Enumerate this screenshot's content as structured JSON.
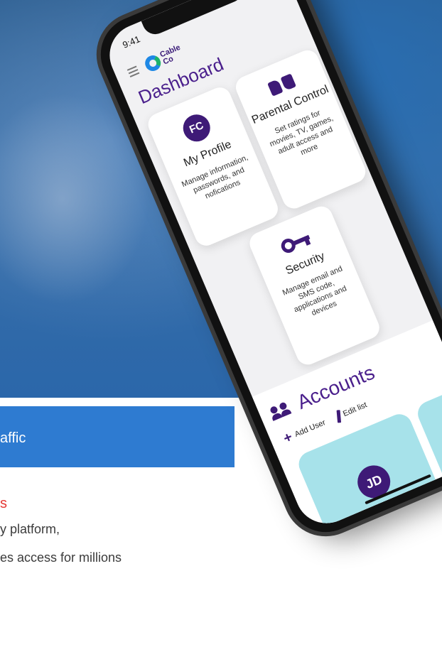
{
  "background": {
    "banner_text": "affic",
    "red_text": "s",
    "body_lines": [
      "y platform,",
      "es access for millions"
    ]
  },
  "status_bar": {
    "time": "9:41"
  },
  "app": {
    "logo_line1": "Cable",
    "logo_line2": "Co",
    "page_title": "Dashboard"
  },
  "cards": [
    {
      "title": "My Profile",
      "desc": "Manage information, passwords, and nofications",
      "icon": "avatar-fc",
      "icon_text": "FC"
    },
    {
      "title": "Parental Control",
      "desc": "Set ratings for movies, TV, games, adult access and more",
      "icon": "thumbs-icon"
    },
    {
      "title": "Security",
      "desc": "Manage email and SMS code, applications and devices",
      "icon": "key-icon"
    }
  ],
  "accounts": {
    "title": "Accounts",
    "add_user": "Add User",
    "edit_list": "Edit list",
    "users": [
      {
        "initials": "JD"
      }
    ]
  },
  "colors": {
    "primary_purple": "#3e1a77",
    "title_purple": "#4a1f8c",
    "banner_blue": "#2e7bd1",
    "card_teal": "#a7e2ea",
    "accent_red": "#e53935"
  }
}
